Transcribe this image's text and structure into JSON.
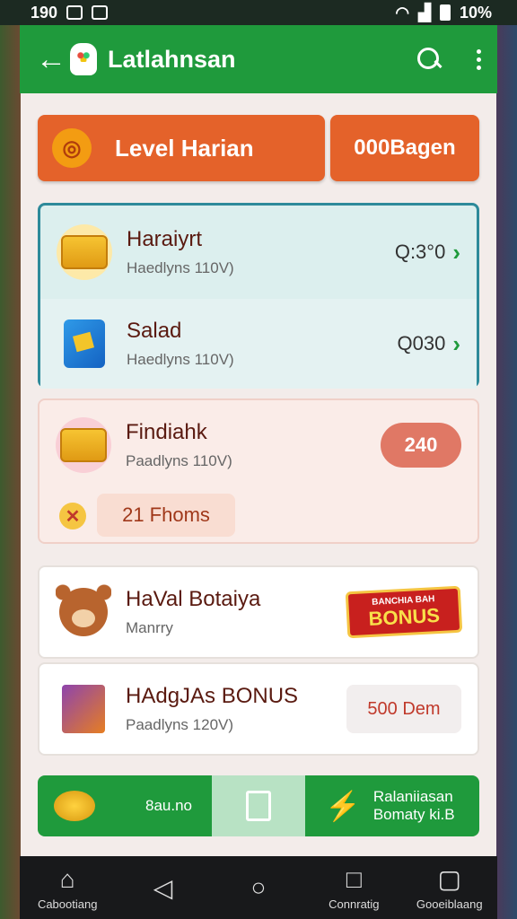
{
  "status": {
    "time": "190",
    "battery": "10%"
  },
  "appbar": {
    "title": "Latlahnsan"
  },
  "level": {
    "label": "Level Harian",
    "badge": "000Bagen"
  },
  "tasks": [
    {
      "title": "Haraiyrt",
      "sub": "Haedlyns 110V)",
      "value": "Q:3°0"
    },
    {
      "title": "Salad",
      "sub": "Haedlyns 110V)",
      "value": "Q030"
    }
  ],
  "find": {
    "title": "Findiahk",
    "sub": "Paadlyns 110V)",
    "value": "240",
    "hours": "21 Fhoms"
  },
  "bear": {
    "title": "HaVal Botaiya",
    "sub": "Manrry",
    "bonus_top": "BANCHIA BAH",
    "bonus": "BONUS"
  },
  "bonus_row": {
    "title": "HAdgJAs BONUS",
    "sub": "Paadlyns 120V)",
    "button": "500 Dem"
  },
  "bottom": {
    "left_value": "8au.no",
    "right_line1": "Ralaniiasan",
    "right_line2": "Bomaty ki.B"
  },
  "nav": [
    {
      "icon": "home-icon",
      "label": "Cabootiang"
    },
    {
      "icon": "back-icon",
      "label": ""
    },
    {
      "icon": "circle-icon",
      "label": ""
    },
    {
      "icon": "square-icon",
      "label": "Connratig"
    },
    {
      "icon": "chat-icon",
      "label": "Gooeiblaang"
    }
  ]
}
